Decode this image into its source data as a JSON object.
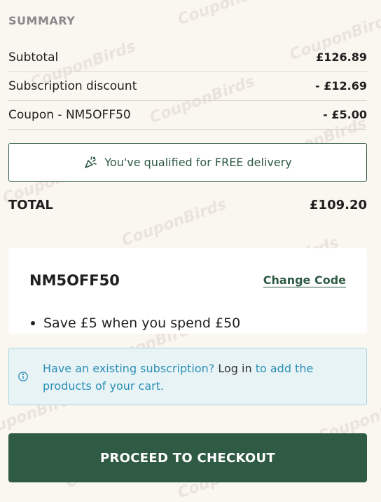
{
  "summary": {
    "title": "SUMMARY",
    "rows": [
      {
        "label": "Subtotal",
        "value": "£126.89"
      },
      {
        "label": "Subscription discount",
        "value": "- £12.69"
      },
      {
        "label": "Coupon - NM5OFF50",
        "value": "- £5.00"
      }
    ],
    "delivery_notice": "You've qualified for FREE delivery",
    "delivery_icon": "party-popper-icon",
    "total_label": "TOTAL",
    "total_value": "£109.20"
  },
  "coupon": {
    "code": "NM5OFF50",
    "change_label": "Change Code",
    "bullets": [
      "Save £5 when you spend £50"
    ]
  },
  "info": {
    "icon": "info-icon",
    "text_before": "Have an existing subscription?",
    "link_text": "Log in",
    "text_after": "to add the products of your cart."
  },
  "checkout": {
    "label": "PROCEED TO CHECKOUT"
  },
  "watermark": {
    "text": "CouponBirds"
  },
  "colors": {
    "brand_green": "#2f5a44",
    "info_blue": "#2b8fb5",
    "background": "#faf6f0"
  }
}
